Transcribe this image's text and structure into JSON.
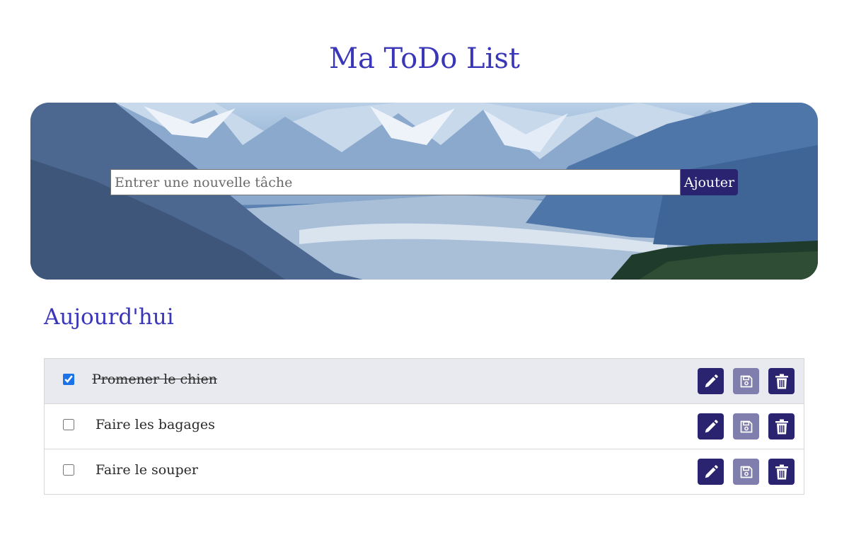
{
  "header": {
    "title": "Ma ToDo List"
  },
  "new_task": {
    "placeholder": "Entrer une nouvelle tâche",
    "value": "",
    "add_label": "Ajouter"
  },
  "section": {
    "title": "Aujourd'hui"
  },
  "tasks": [
    {
      "label": "Promener le chien",
      "done": true
    },
    {
      "label": "Faire les bagages",
      "done": false
    },
    {
      "label": "Faire le souper",
      "done": false
    }
  ],
  "icons": {
    "edit": "pencil-icon",
    "save": "floppy-disk-icon",
    "delete": "trash-icon"
  },
  "colors": {
    "title": "#3a36b8",
    "button": "#2a2470",
    "button_disabled": "#7f7eac",
    "done_row": "#e9eaf0"
  }
}
